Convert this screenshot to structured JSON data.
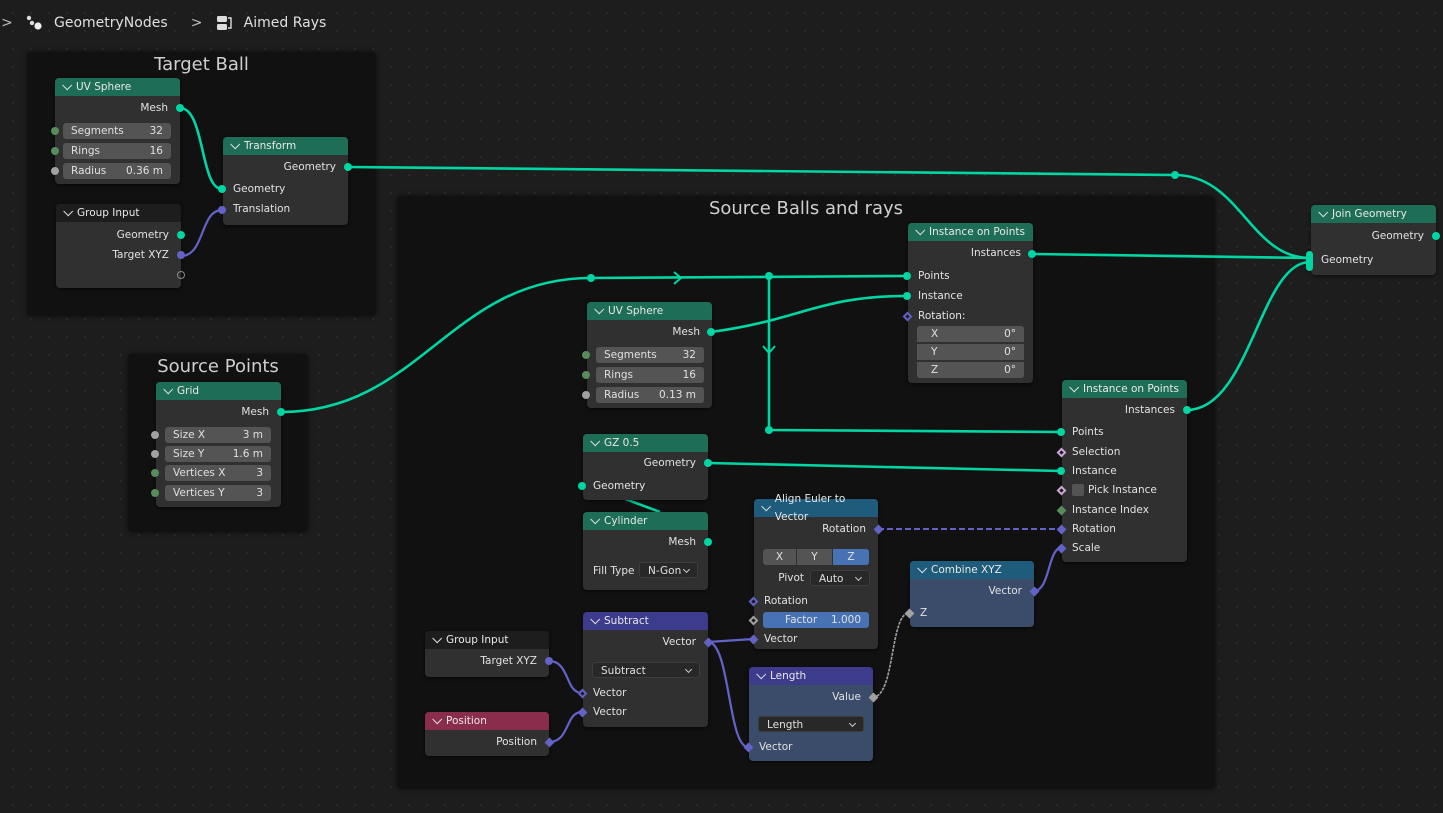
{
  "breadcrumb": {
    "items": [
      {
        "label": "GeometryNodes",
        "icon": "node-tree-icon"
      },
      {
        "label": "Aimed Rays",
        "icon": "node-group-icon"
      }
    ]
  },
  "frames": {
    "target_ball": "Target Ball",
    "source_points": "Source Points",
    "source_balls": "Source Balls and rays"
  },
  "nodes": {
    "uv_sphere_1": {
      "title": "UV Sphere",
      "out_mesh": "Mesh",
      "fields": [
        {
          "label": "Segments",
          "value": "32"
        },
        {
          "label": "Rings",
          "value": "16"
        },
        {
          "label": "Radius",
          "value": "0.36 m"
        }
      ]
    },
    "transform": {
      "title": "Transform",
      "out_geometry": "Geometry",
      "in_geometry": "Geometry",
      "in_translation": "Translation"
    },
    "group_input_1": {
      "title": "Group Input",
      "out_geometry": "Geometry",
      "out_target": "Target XYZ"
    },
    "grid": {
      "title": "Grid",
      "out_mesh": "Mesh",
      "fields": [
        {
          "label": "Size X",
          "value": "3 m"
        },
        {
          "label": "Size Y",
          "value": "1.6 m"
        },
        {
          "label": "Vertices X",
          "value": "3"
        },
        {
          "label": "Vertices Y",
          "value": "3"
        }
      ]
    },
    "uv_sphere_2": {
      "title": "UV Sphere",
      "out_mesh": "Mesh",
      "fields": [
        {
          "label": "Segments",
          "value": "32"
        },
        {
          "label": "Rings",
          "value": "16"
        },
        {
          "label": "Radius",
          "value": "0.13 m"
        }
      ]
    },
    "instance_on_points_1": {
      "title": "Instance on Points",
      "out_instances": "Instances",
      "in_points": "Points",
      "in_instance": "Instance",
      "in_rotation": "Rotation:",
      "rotation": [
        {
          "label": "X",
          "value": "0°"
        },
        {
          "label": "Y",
          "value": "0°"
        },
        {
          "label": "Z",
          "value": "0°"
        }
      ]
    },
    "join_geometry": {
      "title": "Join Geometry",
      "out_geometry": "Geometry",
      "in_geometry": "Geometry"
    },
    "instance_on_points_2": {
      "title": "Instance on Points",
      "out_instances": "Instances",
      "in_points": "Points",
      "in_selection": "Selection",
      "in_instance": "Instance",
      "pick_instance": "Pick Instance",
      "pick_instance_checked": false,
      "in_instance_index": "Instance Index",
      "in_rotation": "Rotation",
      "in_scale": "Scale"
    },
    "gz": {
      "title": "GZ  0.5",
      "out_geometry": "Geometry",
      "in_geometry": "Geometry"
    },
    "cylinder": {
      "title": "Cylinder",
      "out_mesh": "Mesh",
      "fill_type_label": "Fill Type",
      "fill_type_value": "N-Gon"
    },
    "align_euler": {
      "title": "Align Euler to Vector",
      "out_rotation": "Rotation",
      "axes": [
        "X",
        "Y",
        "Z"
      ],
      "axis_selected": "Z",
      "pivot_label": "Pivot",
      "pivot_value": "Auto",
      "in_rotation": "Rotation",
      "factor_label": "Factor",
      "factor_value": "1.000",
      "in_vector": "Vector"
    },
    "combine_xyz": {
      "title": "Combine XYZ",
      "out_vector": "Vector",
      "in_z": "Z"
    },
    "group_input_2": {
      "title": "Group Input",
      "out_target": "Target XYZ"
    },
    "subtract": {
      "title": "Subtract",
      "out_vector": "Vector",
      "operation": "Subtract",
      "in_vector_1": "Vector",
      "in_vector_2": "Vector"
    },
    "position": {
      "title": "Position",
      "out_position": "Position"
    },
    "length": {
      "title": "Length",
      "out_value": "Value",
      "operation": "Length",
      "in_vector": "Vector"
    }
  },
  "colors": {
    "geometry_link": "#00d6a3",
    "vector_link": "#6363c7",
    "float_link": "#a1a1a1",
    "geometry_header": "#1e6e57",
    "vector_header": "#3c3b8c",
    "converter_header": "#1f5b7a",
    "input_header": "#8a2c4c",
    "selected_blue": "#4772b3"
  }
}
